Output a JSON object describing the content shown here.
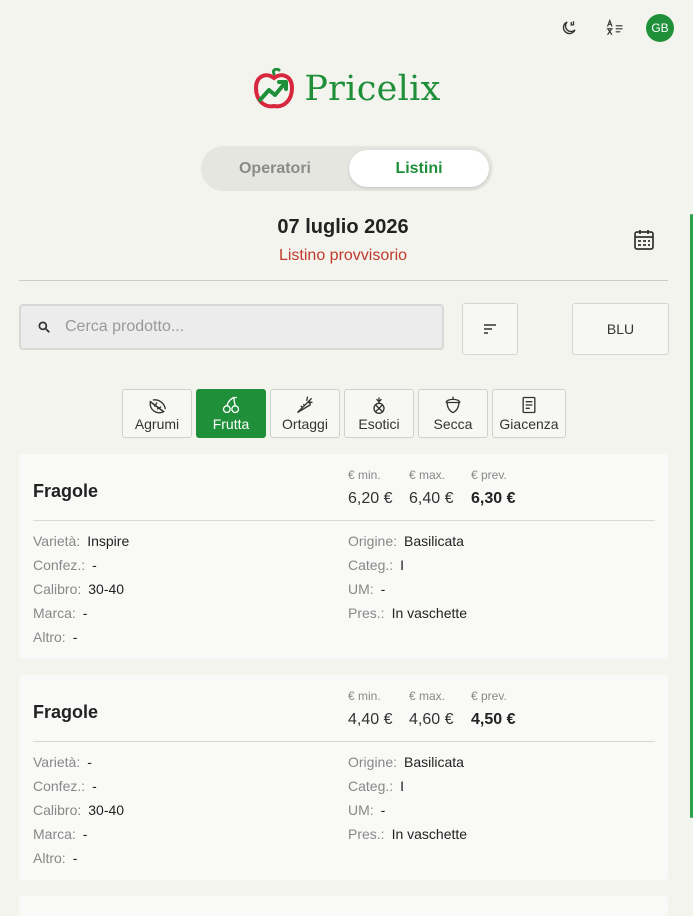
{
  "topbar": {
    "theme_icon": "moon-clock-icon",
    "language_icon": "translate-icon",
    "avatar_initials": "GB"
  },
  "brand": {
    "name": "Pricelix",
    "logo_icon": "apple-chart-icon"
  },
  "tabs": [
    {
      "label": "Operatori",
      "active": false
    },
    {
      "label": "Listini",
      "active": true
    }
  ],
  "header": {
    "date": "07 luglio 2026",
    "status": "Listino provvisorio"
  },
  "search": {
    "placeholder": "Cerca prodotto...",
    "value": ""
  },
  "filter_button": {
    "label": "BLU"
  },
  "categories": [
    {
      "label": "Agrumi",
      "icon": "citrus-slice-icon",
      "active": false
    },
    {
      "label": "Frutta",
      "icon": "cherries-icon",
      "active": true
    },
    {
      "label": "Ortaggi",
      "icon": "carrot-icon",
      "active": false
    },
    {
      "label": "Esotici",
      "icon": "pineapple-icon",
      "active": false
    },
    {
      "label": "Secca",
      "icon": "acorn-icon",
      "active": false
    },
    {
      "label": "Giacenza",
      "icon": "list-doc-icon",
      "active": false
    }
  ],
  "price_labels": {
    "min": "€ min.",
    "max": "€ max.",
    "prev": "€ prev."
  },
  "products": [
    {
      "name": "Fragole",
      "min": "6,20 €",
      "max": "6,40 €",
      "prev": "6,30 €",
      "left": [
        {
          "k": "Varietà:",
          "v": "Inspire"
        },
        {
          "k": "Confez.:",
          "v": "-"
        },
        {
          "k": "Calibro:",
          "v": "30-40"
        },
        {
          "k": "Marca:",
          "v": "-"
        },
        {
          "k": "Altro:",
          "v": "-"
        }
      ],
      "right": [
        {
          "k": "Origine:",
          "v": "Basilicata"
        },
        {
          "k": "Categ.:",
          "v": "I"
        },
        {
          "k": "UM:",
          "v": "-"
        },
        {
          "k": "Pres.:",
          "v": "In vaschette"
        }
      ]
    },
    {
      "name": "Fragole",
      "min": "4,40 €",
      "max": "4,60 €",
      "prev": "4,50 €",
      "left": [
        {
          "k": "Varietà:",
          "v": "-"
        },
        {
          "k": "Confez.:",
          "v": "-"
        },
        {
          "k": "Calibro:",
          "v": "30-40"
        },
        {
          "k": "Marca:",
          "v": "-"
        },
        {
          "k": "Altro:",
          "v": "-"
        }
      ],
      "right": [
        {
          "k": "Origine:",
          "v": "Basilicata"
        },
        {
          "k": "Categ.:",
          "v": "I"
        },
        {
          "k": "UM:",
          "v": "-"
        },
        {
          "k": "Pres.:",
          "v": "In vaschette"
        }
      ]
    }
  ],
  "colors": {
    "brand": "#1f8f3a",
    "status": "#c0392b",
    "background": "#f4f4ef"
  }
}
